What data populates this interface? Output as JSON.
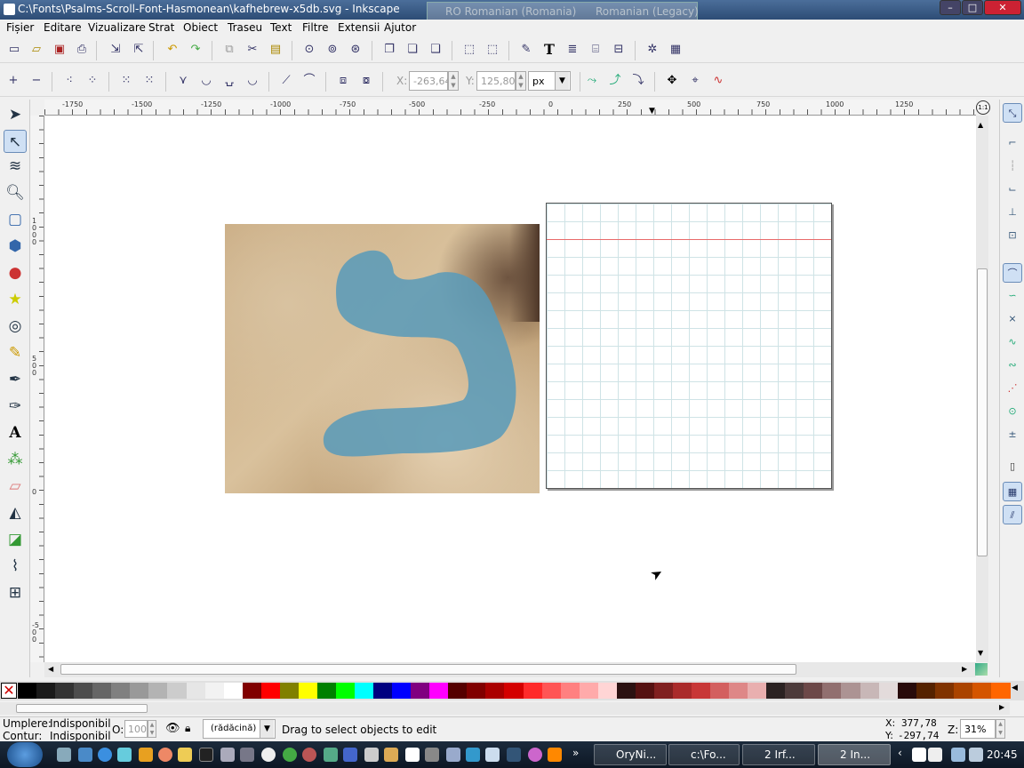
{
  "window": {
    "title": "C:\\Fonts\\Psalms-Scroll-Font-Hasmonean\\kafhebrew-x5db.svg - Inkscape",
    "language_bar": [
      "RO Romanian (Romania)",
      "Romanian (Legacy)"
    ]
  },
  "menu": [
    "Fișier",
    "Editare",
    "Vizualizare",
    "Strat",
    "Obiect",
    "Traseu",
    "Text",
    "Filtre",
    "Extensii",
    "Ajutor"
  ],
  "node_toolbar": {
    "x_label": "X:",
    "x_value": "-263,649",
    "y_label": "Y:",
    "y_value": "125,802",
    "unit": "px"
  },
  "ruler": {
    "h_labels": [
      "-1750",
      "-1500",
      "-1250",
      "-1000",
      "-750",
      "-500",
      "-250",
      "0",
      "250",
      "500",
      "750",
      "1000",
      "1250"
    ],
    "v_labels": [
      "1000",
      "500",
      "0",
      "-500"
    ]
  },
  "status": {
    "fill_label": "Umplere:",
    "fill_value": "Indisponibil",
    "stroke_label": "Contur:",
    "stroke_value": "Indisponibil",
    "opacity_label": "O:",
    "opacity_value": "100",
    "layer": "(rădăcină)",
    "message": "Drag to select objects to edit",
    "cursor_x": "377,78",
    "cursor_y": "-297,74",
    "x_prefix": "X:",
    "y_prefix": "Y:",
    "zoom_label": "Z:",
    "zoom_value": "31%"
  },
  "taskbar": {
    "tasks": [
      "OryNi...",
      "c:\\Fo...",
      "2 Irf...",
      "2 In..."
    ],
    "clock": "20:45"
  },
  "colors": {
    "accent": "#2d4c75",
    "glyph": "#5b9bb8",
    "guide": "#e86a6a"
  },
  "palette": [
    "#000000",
    "#1a1a1a",
    "#333333",
    "#4d4d4d",
    "#666666",
    "#808080",
    "#999999",
    "#b3b3b3",
    "#cccccc",
    "#e6e6e6",
    "#f2f2f2",
    "#ffffff",
    "#800000",
    "#ff0000",
    "#808000",
    "#ffff00",
    "#008000",
    "#00ff00",
    "#00ffff",
    "#000080",
    "#0000ff",
    "#800080",
    "#ff00ff",
    "#550000",
    "#800000",
    "#aa0000",
    "#d40000",
    "#ff2a2a",
    "#ff5555",
    "#ff8080",
    "#ffaaaa",
    "#ffd5d5",
    "#2b1111",
    "#551111",
    "#802020",
    "#aa2b2b",
    "#c83737",
    "#d35f5f",
    "#de8787",
    "#e9afaf",
    "#2b2222",
    "#4d3b3b",
    "#6c4848",
    "#916f6f",
    "#ac9393",
    "#c8b7b7",
    "#e3dbdb",
    "#280b0b",
    "#552200",
    "#803300",
    "#aa4400",
    "#d45500",
    "#ff6600"
  ]
}
